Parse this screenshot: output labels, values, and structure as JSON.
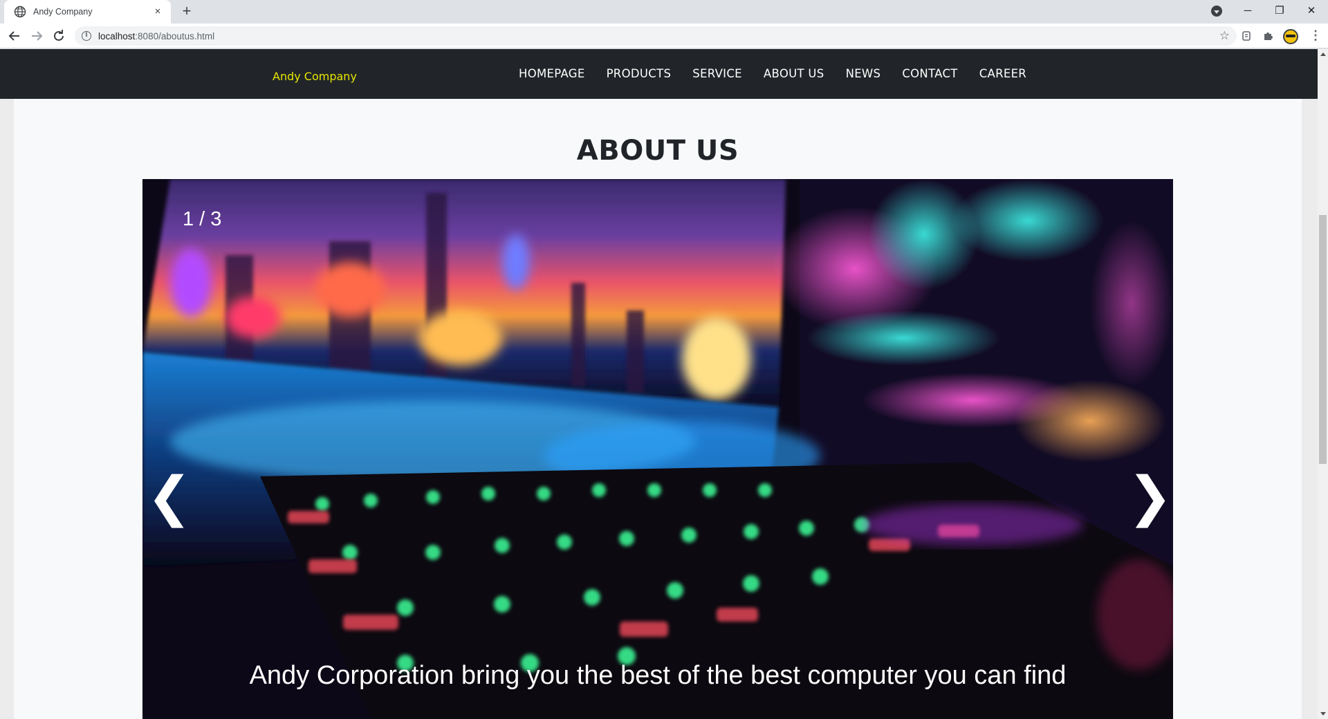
{
  "browser": {
    "tab_title": "Andy Company",
    "tab_close": "×",
    "new_tab": "+",
    "url_host": "localhost",
    "url_path": ":8080/aboutus.html",
    "window_minimize": "─",
    "window_restore": "❐",
    "window_close": "✕"
  },
  "site": {
    "brand": "Andy Company",
    "brand_color": "#e6e600",
    "nav_bg": "#212529",
    "menu": [
      {
        "label": "HOMEPAGE"
      },
      {
        "label": "PRODUCTS"
      },
      {
        "label": "SERVICE"
      },
      {
        "label": "ABOUT US"
      },
      {
        "label": "NEWS"
      },
      {
        "label": "CONTACT"
      },
      {
        "label": "CAREER"
      }
    ]
  },
  "main": {
    "title": "ABOUT US",
    "slideshow": {
      "counter": "1 / 3",
      "prev_label": "❮",
      "next_label": "❯",
      "caption": "Andy Corporation bring you the best of the best computer you can find"
    }
  },
  "icons": {
    "back": "back-arrow-icon",
    "forward": "forward-arrow-icon",
    "reload": "reload-icon",
    "info": "info-icon",
    "bookmark": "star-icon",
    "extensions": "puzzle-icon",
    "menu": "kebab-menu-icon"
  }
}
